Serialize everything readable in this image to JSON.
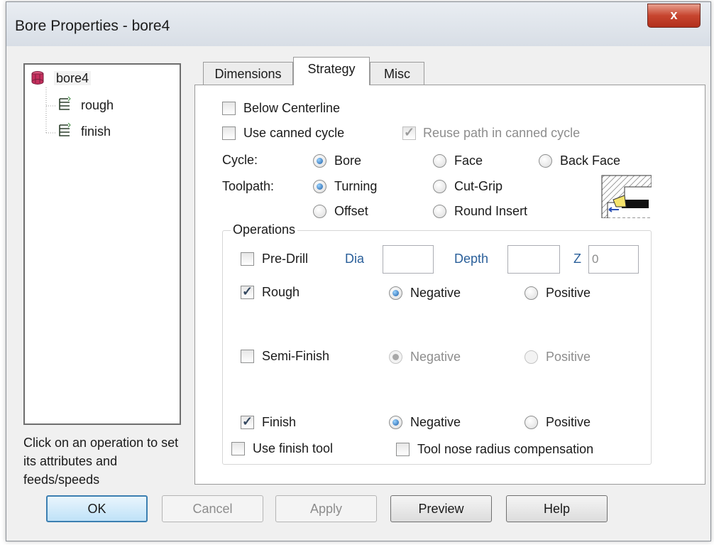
{
  "window": {
    "title": "Bore Properties - bore4",
    "close_glyph": "x"
  },
  "tree": {
    "items": [
      {
        "label": "bore4",
        "icon": "bore-icon"
      },
      {
        "label": "rough",
        "icon": "operation-icon"
      },
      {
        "label": "finish",
        "icon": "operation-icon"
      }
    ],
    "hint": "Click on an operation to set its attributes and feeds/speeds"
  },
  "tabs": [
    {
      "label": "Dimensions",
      "active": false
    },
    {
      "label": "Strategy",
      "active": true
    },
    {
      "label": "Misc",
      "active": false
    }
  ],
  "strategy": {
    "below_centerline": {
      "label": "Below Centerline",
      "checked": false
    },
    "use_canned_cycle": {
      "label": "Use canned cycle",
      "checked": false
    },
    "reuse_path": {
      "label": "Reuse path in canned cycle",
      "checked": true,
      "disabled": true
    },
    "cycle": {
      "label": "Cycle:",
      "options": [
        "Bore",
        "Face",
        "Back Face"
      ],
      "selected": "Bore"
    },
    "toolpath": {
      "label": "Toolpath:",
      "options": [
        "Turning",
        "Cut-Grip",
        "Offset",
        "Round Insert"
      ],
      "selected": "Turning"
    }
  },
  "operations": {
    "title": "Operations",
    "pre_drill": {
      "label": "Pre-Drill",
      "checked": false,
      "dia_label": "Dia",
      "dia_value": "",
      "depth_label": "Depth",
      "depth_value": "",
      "z_label": "Z",
      "z_value": "0"
    },
    "rough": {
      "label": "Rough",
      "checked": true,
      "negative": "Negative",
      "positive": "Positive",
      "selected": "Negative"
    },
    "semi_finish": {
      "label": "Semi-Finish",
      "checked": false,
      "negative": "Negative",
      "positive": "Positive",
      "selected": "Negative",
      "disabled": true
    },
    "finish": {
      "label": "Finish",
      "checked": true,
      "negative": "Negative",
      "positive": "Positive",
      "selected": "Negative"
    },
    "use_finish_tool": {
      "label": "Use finish tool",
      "checked": false
    },
    "tool_nose": {
      "label": "Tool nose radius compensation",
      "checked": false
    }
  },
  "buttons": {
    "ok": "OK",
    "cancel": "Cancel",
    "apply": "Apply",
    "preview": "Preview",
    "help": "Help"
  },
  "colors": {
    "accent": "#3c7fb1",
    "link_blue": "#2a5f9a",
    "close_red": "#c7452f"
  }
}
